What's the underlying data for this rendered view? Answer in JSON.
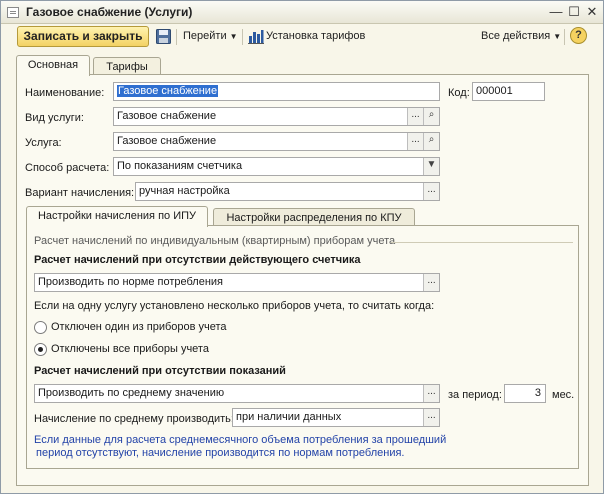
{
  "window": {
    "title": "Газовое снабжение (Услуги)",
    "controls": {
      "minimize": "—",
      "maximize": "☐",
      "close": "✕"
    }
  },
  "toolbar": {
    "save_close": "Записать и закрыть",
    "go": "Перейти",
    "tariffs": "Установка тарифов",
    "all_actions": "Все действия",
    "help": "?"
  },
  "tabs": [
    "Основная",
    "Тарифы"
  ],
  "form": {
    "name_label": "Наименование:",
    "name_value": "Газовое снабжение",
    "code_label": "Код:",
    "code_value": "000001",
    "service_type_label": "Вид услуги:",
    "service_type_value": "Газовое снабжение",
    "service_label": "Услуга:",
    "service_value": "Газовое снабжение",
    "calc_method_label": "Способ расчета:",
    "calc_method_value": "По показаниям счетчика",
    "accrual_variant_label": "Вариант начисления:",
    "accrual_variant_value": "ручная настройка"
  },
  "subtabs": [
    "Настройки начисления по ИПУ",
    "Настройки распределения по КПУ"
  ],
  "ipu": {
    "group_title": "Расчет начислений по индивидуальным (квартирным) приборам учета",
    "no_meter_title": "Расчет начислений при отсутствии действующего счетчика",
    "no_meter_value": "Производить по норме потребления",
    "multi_meter_question": "Если на одну услугу установлено несколько приборов учета, то считать когда:",
    "radio_one_off": "Отключен один из приборов учета",
    "radio_all_off": "Отключены все приборы учета",
    "radio_selected": "all_off",
    "no_readings_title": "Расчет начислений при отсутствии показаний",
    "no_readings_value": "Производить по среднему значению",
    "period_label": "за период:",
    "period_value": "3",
    "period_unit": "мес.",
    "avg_label": "Начисление по среднему производить:",
    "avg_value": "при наличии данных",
    "note_line1": "Если данные для расчета среднемесячного объема потребления за прошедший",
    "note_line2": "период отсутствуют, начисление производится по нормам потребления."
  },
  "icons": {
    "app": "document-icon",
    "save": "floppy-disk-icon",
    "tariffs": "bar-chart-icon",
    "choose": "ellipsis-icon",
    "open": "magnifier-icon",
    "dropdown": "triangle-down-icon"
  },
  "colors": {
    "accent_button": "#f3d264",
    "panel_background": "#fbfaf1",
    "selection": "#2f6fd0",
    "note_text": "#2343a8"
  }
}
